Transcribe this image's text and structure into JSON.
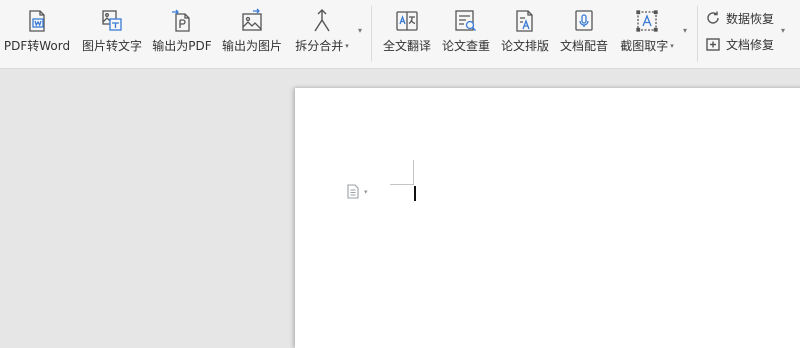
{
  "toolbar": {
    "buttons": [
      {
        "label": "PDF转Word",
        "icon": "pdf-to-word-icon"
      },
      {
        "label": "图片转文字",
        "icon": "image-to-text-icon"
      },
      {
        "label": "输出为PDF",
        "icon": "export-pdf-icon"
      },
      {
        "label": "输出为图片",
        "icon": "export-image-icon"
      },
      {
        "label": "拆分合并",
        "icon": "split-merge-icon",
        "has_dropdown": true
      },
      {
        "label": "全文翻译",
        "icon": "translate-icon"
      },
      {
        "label": "论文查重",
        "icon": "plagiarism-check-icon"
      },
      {
        "label": "论文排版",
        "icon": "paper-layout-icon"
      },
      {
        "label": "文档配音",
        "icon": "dubbing-icon"
      },
      {
        "label": "截图取字",
        "icon": "screenshot-ocr-icon",
        "has_dropdown": true
      }
    ],
    "side_buttons": [
      {
        "label": "数据恢复",
        "icon": "data-recovery-icon"
      },
      {
        "label": "文档修复",
        "icon": "doc-repair-icon"
      }
    ],
    "more_glyph": "▾",
    "caret_glyph": "▾"
  },
  "colors": {
    "ribbon_bg": "#f6f6f6",
    "workspace_bg": "#e6e6e6",
    "icon_stroke": "#555555",
    "icon_accent": "#3a7bd5"
  }
}
